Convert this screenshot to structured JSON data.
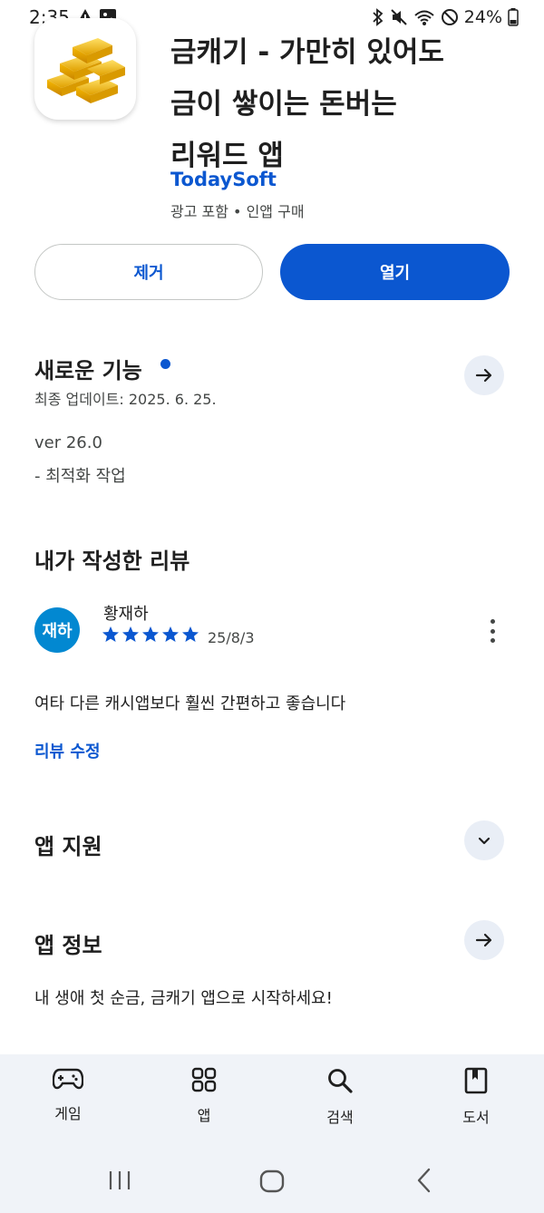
{
  "status": {
    "time": "2:35",
    "battery": "24%"
  },
  "app": {
    "title_lines": [
      "금캐기 - 가만히 있어도",
      "금이 쌓이는 돈버는",
      "리워드 앱"
    ],
    "developer": "TodaySoft",
    "meta": "광고 포함 • 인앱 구매"
  },
  "buttons": {
    "remove": "제거",
    "open": "열기"
  },
  "whats_new": {
    "title": "새로운 기능",
    "updated": "최종 업데이트: 2025. 6. 25.",
    "version": "ver 26.0",
    "note": "- 최적화 작업"
  },
  "my_review": {
    "title": "내가 작성한 리뷰",
    "avatar_text": "재하",
    "reviewer": "황재하",
    "rating": 5,
    "date": "25/8/3",
    "text": "여타 다른 캐시앱보다 훨씬 간편하고 좋습니다",
    "edit_label": "리뷰 수정"
  },
  "app_support": {
    "title": "앱 지원"
  },
  "app_info": {
    "title": "앱 정보",
    "description": "내 생애 첫 순금, 금캐기 앱으로 시작하세요!"
  },
  "bottom_nav": {
    "items": [
      {
        "label": "게임",
        "icon": "gamepad-icon"
      },
      {
        "label": "앱",
        "icon": "apps-grid-icon"
      },
      {
        "label": "검색",
        "icon": "search-icon"
      },
      {
        "label": "도서",
        "icon": "book-icon"
      }
    ]
  },
  "colors": {
    "accent": "#0b57d0",
    "avatar": "#0288d1",
    "nav_bg": "#f0f3f8",
    "chip_bg": "#e9eef6"
  }
}
